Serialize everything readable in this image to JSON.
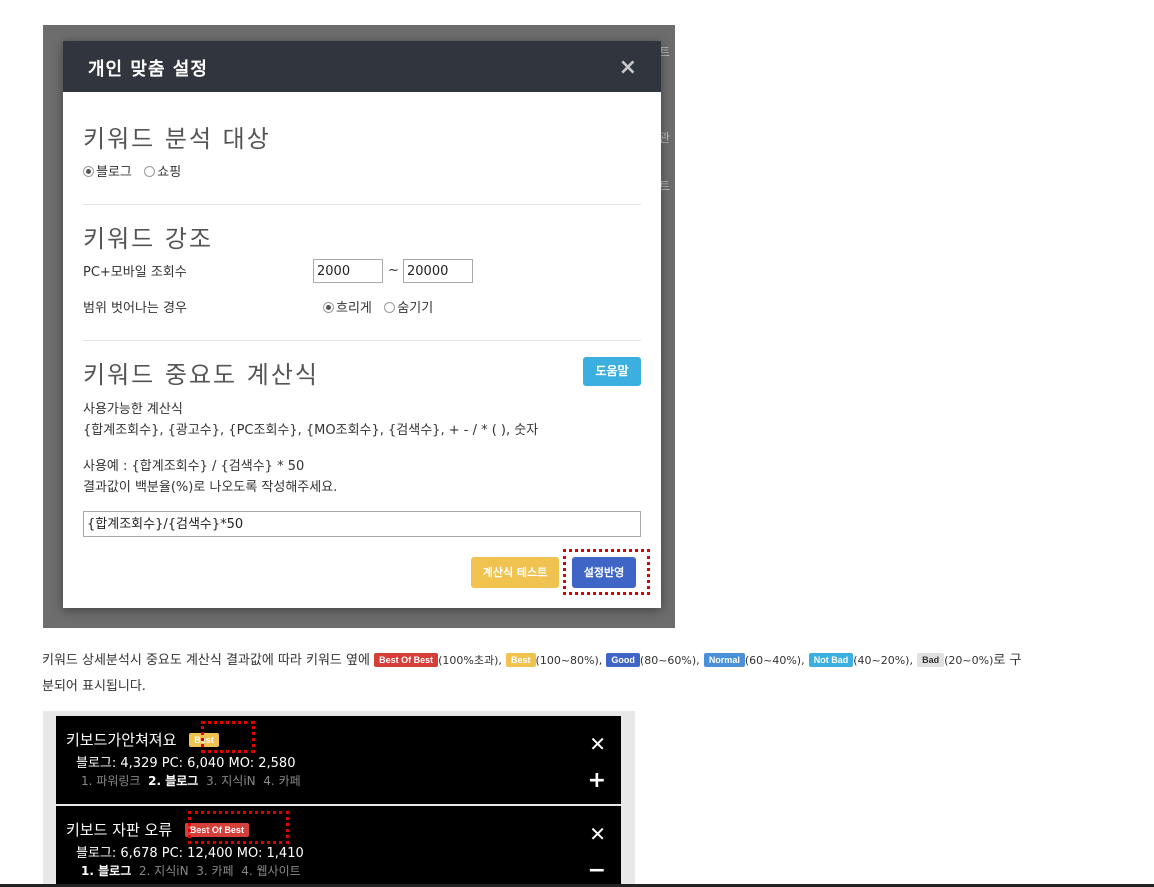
{
  "background": {
    "right_chars": [
      "트",
      "관",
      "트"
    ]
  },
  "modal": {
    "title": "개인 맞춤 설정",
    "close": "×",
    "section1": {
      "title": "키워드 분석 대상",
      "option1": "블로그",
      "option2": "쇼핑"
    },
    "section2": {
      "title": "키워드 강조",
      "views_label": "PC+모바일 조회수",
      "min_value": "2000",
      "range_sep": "~",
      "max_value": "20000",
      "out_of_range_label": "범위 벗어나는 경우",
      "option_blur": "흐리게",
      "option_hide": "숨기기"
    },
    "section3": {
      "title": "키워드 중요도 계산식",
      "help_button": "도움말",
      "available_label": "사용가능한 계산식",
      "available_vars": "{합계조회수}, {광고수}, {PC조회수}, {MO조회수}, {검색수}, + - / * ( ), 숫자",
      "example": "사용예 : {합계조회수} / {검색수} * 50",
      "instruction": "결과값이 백분율(%)로 나오도록 작성해주세요.",
      "formula": "{합계조회수}/{검색수}*50"
    },
    "buttons": {
      "test": "계산식 테스트",
      "apply": "설정반영"
    }
  },
  "description": {
    "intro": "키워드 상세분석시 중요도 계산식 결과값에 따라 키워드 옆에",
    "badges": [
      {
        "label": "Best Of Best",
        "range": "(100%초과),",
        "color": "#d43f3a"
      },
      {
        "label": "Best",
        "range": "(100~80%),",
        "color": "#f0c24f"
      },
      {
        "label": "Good",
        "range": "(80~60%),",
        "color": "#3f66c6"
      },
      {
        "label": "Normal",
        "range": "(60~40%),",
        "color": "#4a90d9"
      },
      {
        "label": "Not Bad",
        "range": "(40~20%),",
        "color": "#3bb0e0"
      },
      {
        "label": "Bad",
        "range": "(20~0%)",
        "color": "#e0e0e0"
      }
    ],
    "outro_end": "로 구",
    "line2": "분되어 표시됩니다."
  },
  "keywords": [
    {
      "title": "키보드가안쳐져요",
      "badge": "Best",
      "stats": "블로그: 4,329   PC: 6,040   MO: 2,580",
      "links": [
        {
          "n": "1.",
          "label": "파워링크",
          "bold": false
        },
        {
          "n": "2.",
          "label": "블로그",
          "bold": true
        },
        {
          "n": "3.",
          "label": "지식iN",
          "bold": false
        },
        {
          "n": "4.",
          "label": "카페",
          "bold": false
        }
      ],
      "close": "✕",
      "toggle": "+"
    },
    {
      "title": "키보드 자판 오류",
      "badge": "Best Of Best",
      "stats": "블로그: 6,678   PC: 12,400   MO: 1,410",
      "links": [
        {
          "n": "1.",
          "label": "블로그",
          "bold": true
        },
        {
          "n": "2.",
          "label": "지식iN",
          "bold": false
        },
        {
          "n": "3.",
          "label": "카페",
          "bold": false
        },
        {
          "n": "4.",
          "label": "웹사이트",
          "bold": false
        }
      ],
      "close": "✕",
      "toggle": "−"
    }
  ]
}
